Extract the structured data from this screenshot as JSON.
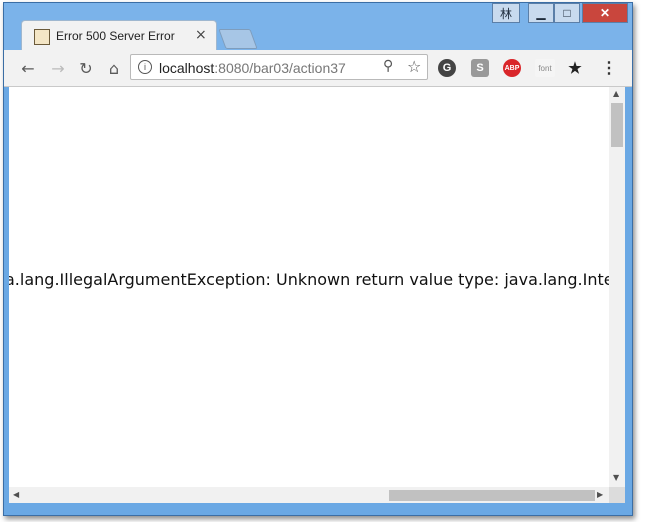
{
  "window": {
    "user_badge": "林",
    "minimize": "▁",
    "maximize": "□",
    "close": "✕"
  },
  "tab": {
    "title": "Error 500 Server Error",
    "close": "×",
    "favicon": "page-favicon"
  },
  "toolbar": {
    "back": "←",
    "forward": "→",
    "reload": "↻",
    "home": "⌂",
    "url_host": "localhost",
    "url_rest": ":8080/bar03/action37",
    "info_icon": "i",
    "zoom_icon": "⚲",
    "bookmark_icon": "☆"
  },
  "extensions": {
    "g": "G",
    "s": "S",
    "abp": "ABP",
    "font": "font",
    "star": "★",
    "menu": "⋮"
  },
  "page": {
    "error_text": "a.lang.IllegalArgumentException: Unknown return value type: java.lang.Integer"
  },
  "scrollbars": {
    "up": "▲",
    "down": "▼",
    "left": "◀",
    "right": "▶"
  }
}
